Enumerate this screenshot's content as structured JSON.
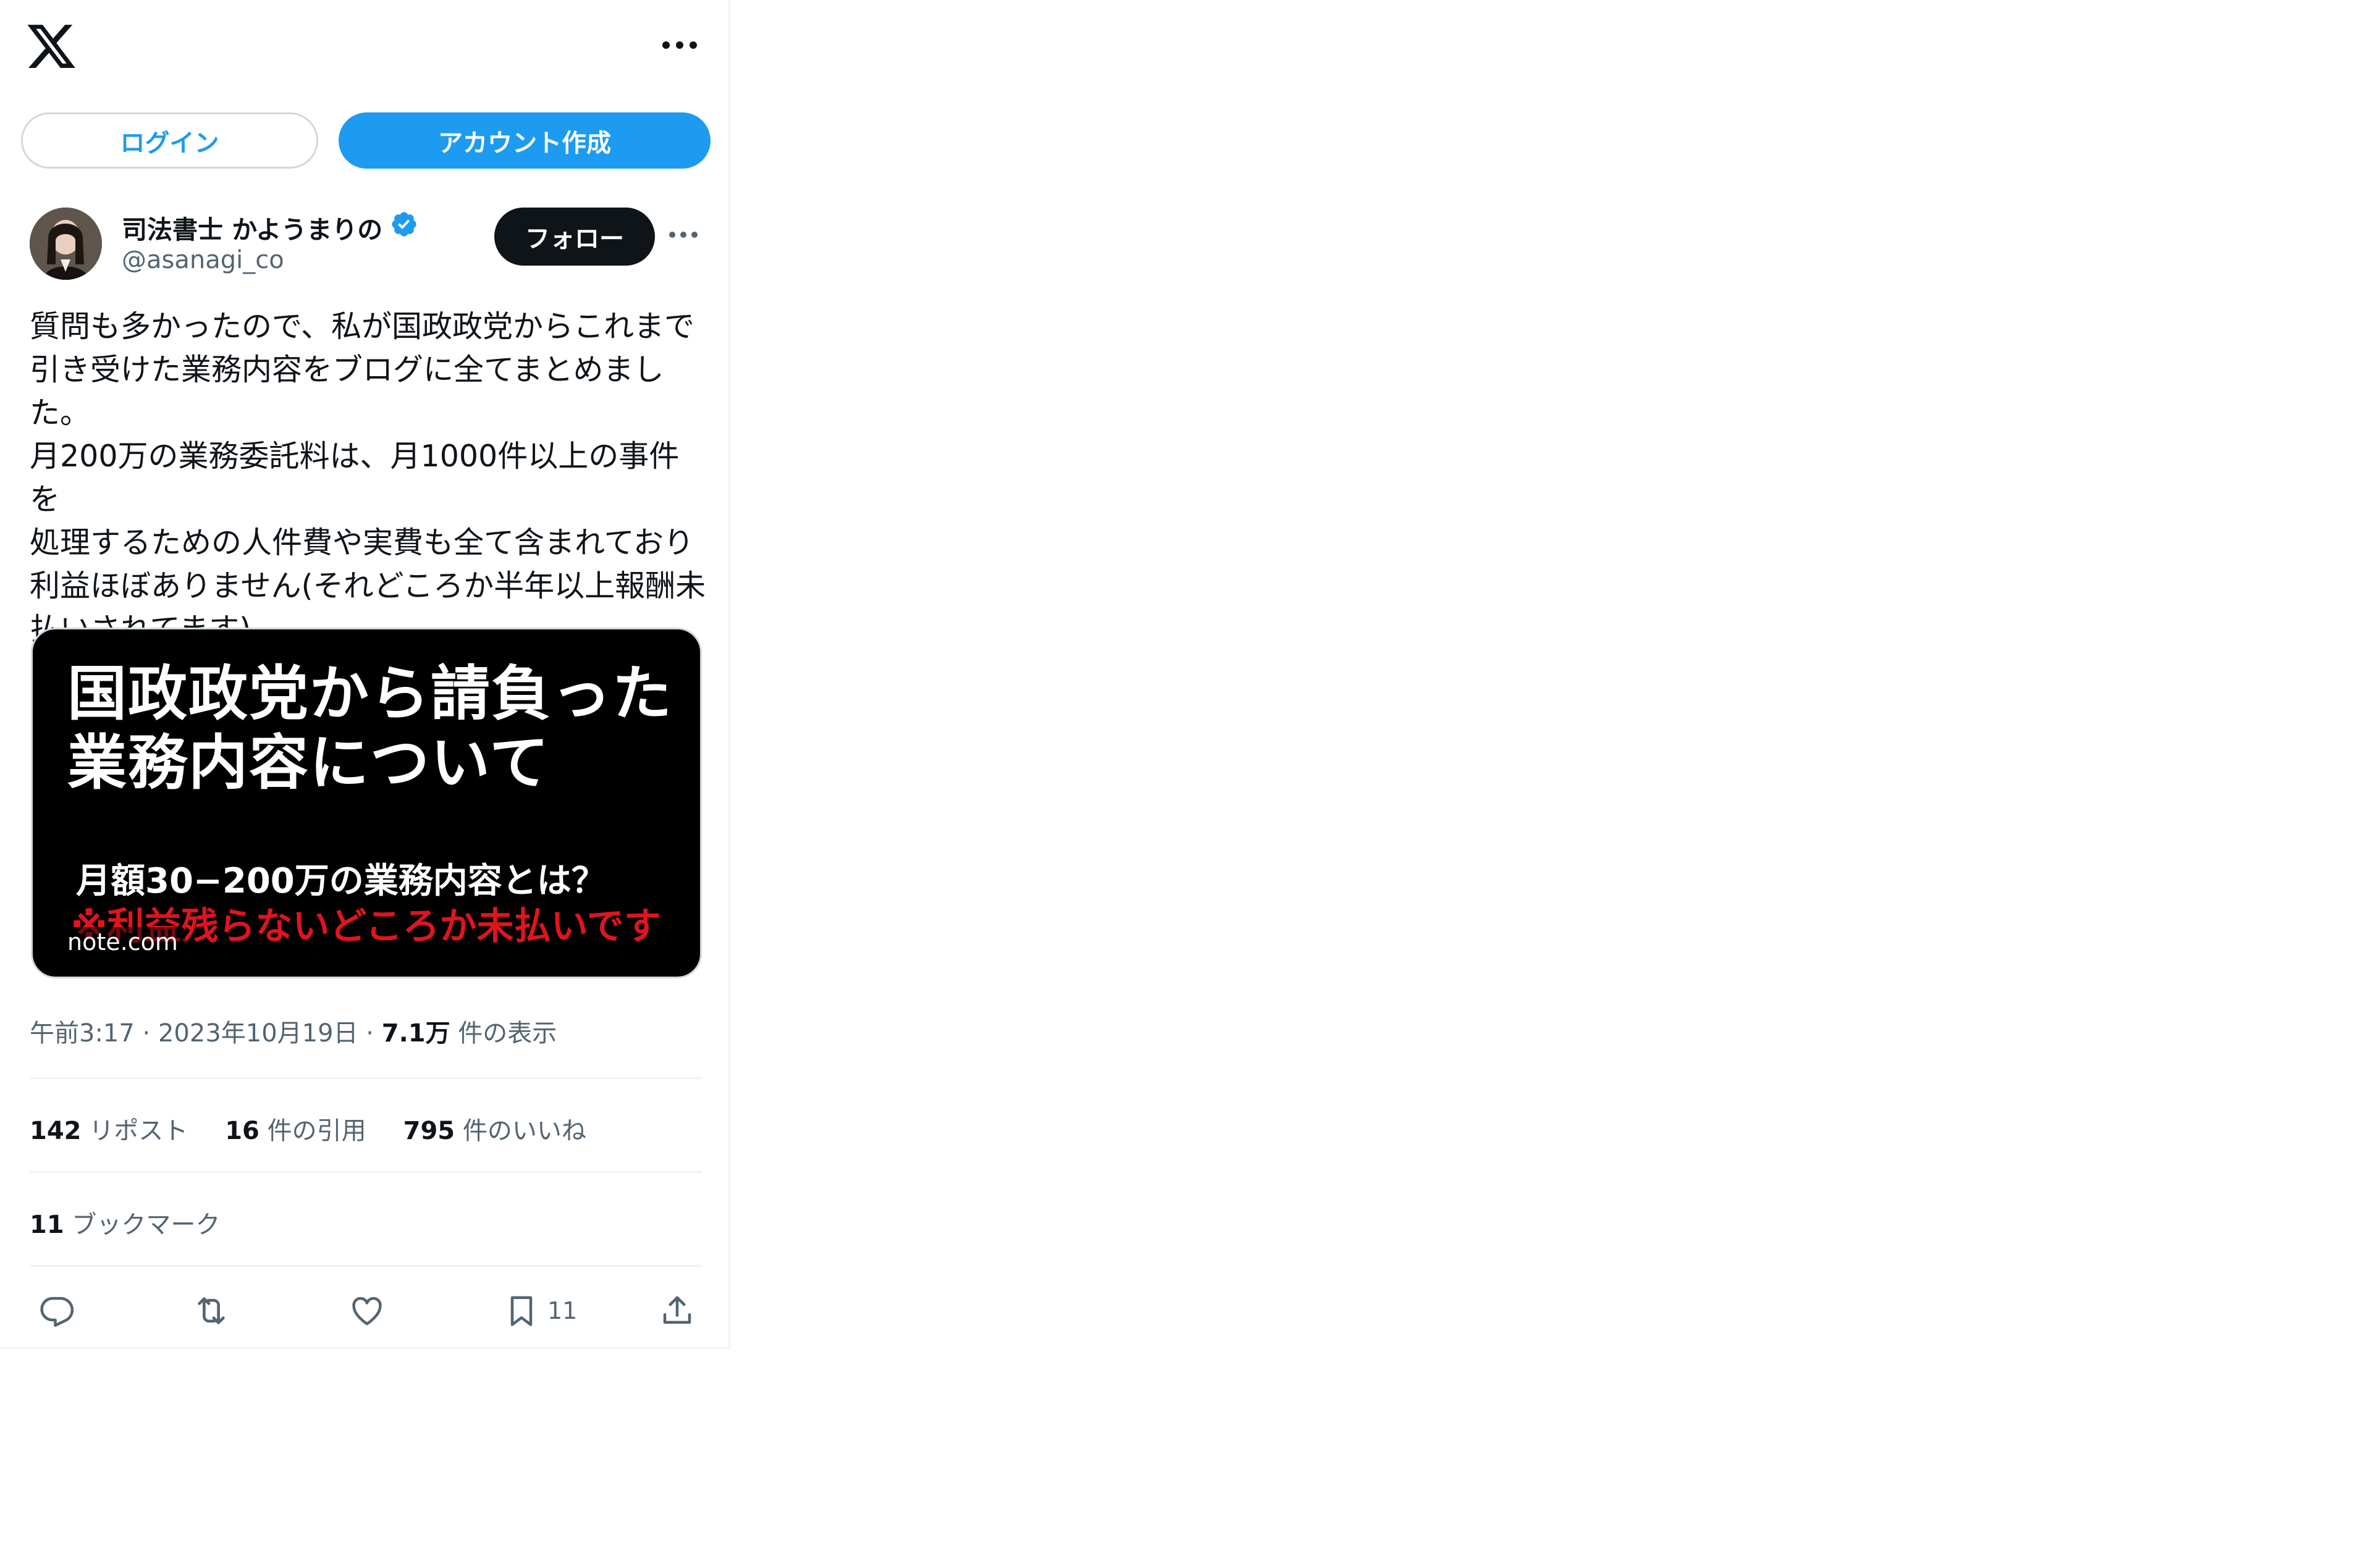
{
  "header": {
    "logo": "x-logo-icon",
    "more": "more-horizontal-icon"
  },
  "auth": {
    "login_label": "ログイン",
    "signup_label": "アカウント作成"
  },
  "author": {
    "name": "司法書士 かようまりの",
    "handle": "@asanagi_co",
    "verified": true,
    "follow_label": "フォロー"
  },
  "post": {
    "text": "質問も多かったので、私が国政政党からこれまで\n引き受けた業務内容をブログに全てまとめまし\nた。\n月200万の業務委託料は、月1000件以上の事件を\n処理するための人件費や実費も全て含まれており\n利益ほぼありません(それどころか半年以上報酬未\n払いされてます)。",
    "card": {
      "title": "国政政党から請負った\n業務内容について",
      "subtitle": "月額30−200万の業務内容とは？",
      "warning": "※利益残らないどころか未払いです",
      "domain": "note.com"
    },
    "meta": {
      "time": "午前3:17",
      "date": "2023年10月19日",
      "separator": "·",
      "views_count": "7.1万",
      "views_label": "件の表示"
    },
    "stats": {
      "reposts_count": "142",
      "reposts_label": "リポスト",
      "quotes_count": "16",
      "quotes_label": "件の引用",
      "likes_count": "795",
      "likes_label": "件のいいね",
      "bookmarks_count": "11",
      "bookmarks_label": "ブックマーク"
    },
    "actions": {
      "bookmark_count": "11"
    }
  },
  "colors": {
    "accent": "#1d9bf0",
    "text": "#0f1419",
    "muted": "#536471",
    "warning": "#e0141e"
  }
}
